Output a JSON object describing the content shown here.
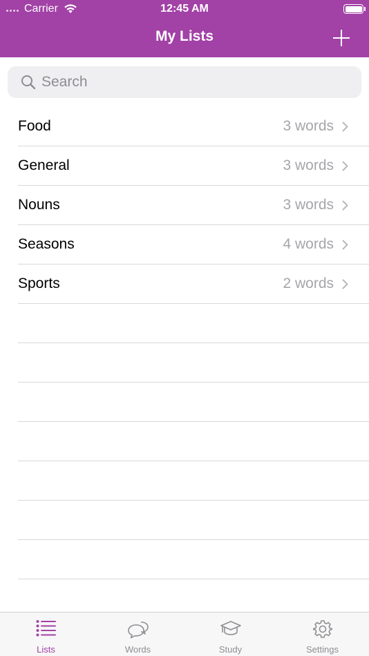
{
  "status_bar": {
    "carrier": "Carrier",
    "time": "12:45 AM"
  },
  "nav": {
    "title": "My Lists",
    "add_icon": "plus-icon"
  },
  "search": {
    "placeholder": "Search"
  },
  "lists": [
    {
      "name": "Food",
      "count": "3 words"
    },
    {
      "name": "General",
      "count": "3 words"
    },
    {
      "name": "Nouns",
      "count": "3 words"
    },
    {
      "name": "Seasons",
      "count": "4 words"
    },
    {
      "name": "Sports",
      "count": "2 words"
    }
  ],
  "tabs": [
    {
      "label": "Lists",
      "icon": "list-icon",
      "active": true
    },
    {
      "label": "Words",
      "icon": "speech-bubbles-icon",
      "active": false
    },
    {
      "label": "Study",
      "icon": "graduation-cap-icon",
      "active": false
    },
    {
      "label": "Settings",
      "icon": "gear-icon",
      "active": false
    }
  ],
  "colors": {
    "accent": "#a241a6",
    "inactive": "#8e8e93",
    "secondary_text": "#a5a5aa"
  }
}
